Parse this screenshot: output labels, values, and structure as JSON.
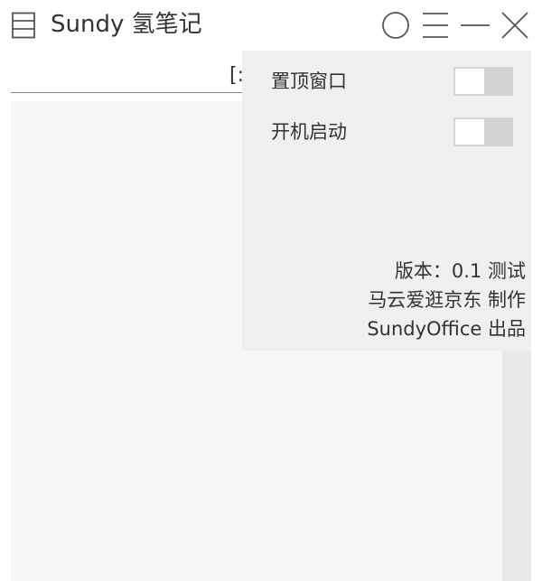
{
  "window": {
    "title": "Sundy 氢笔记",
    "app_icon": "notebook-list-icon",
    "buttons": {
      "pin": "circle-pin-icon",
      "menu": "hamburger-menu-icon",
      "minimize": "minimize-icon",
      "close": "close-icon"
    }
  },
  "search": {
    "visible_text": "[:"
  },
  "settings": {
    "items": [
      {
        "label": "置顶窗口",
        "enabled": false
      },
      {
        "label": "开机启动",
        "enabled": false
      }
    ],
    "info": {
      "version": "版本：0.1 测试",
      "author": "马云爱逛京东 制作",
      "publisher": "SundyOffice 出品"
    }
  },
  "colors": {
    "background": "#ffffff",
    "panel": "#efefef",
    "content": "#f7f7f7",
    "toggle_track": "#d4d4d4",
    "text": "#333333",
    "icon": "#555555"
  }
}
